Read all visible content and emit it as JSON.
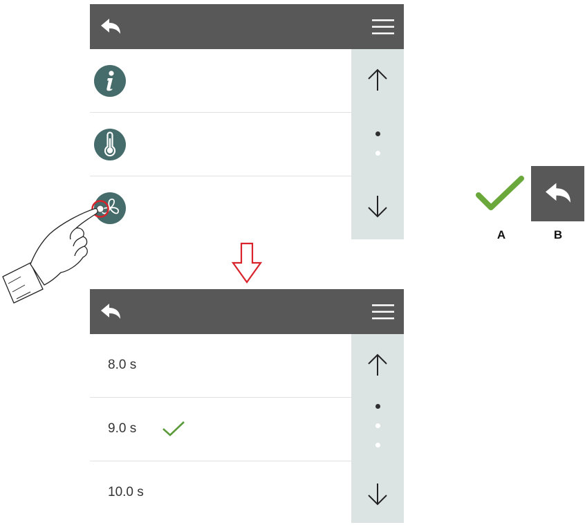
{
  "settings_list": {
    "items": [
      {
        "icon": "info-icon"
      },
      {
        "icon": "thermometer-icon"
      },
      {
        "icon": "fan-icon"
      }
    ],
    "scroll_dots": {
      "total": 2,
      "active": 1
    }
  },
  "value_list": {
    "items": [
      {
        "label": "8.0 s",
        "selected": false
      },
      {
        "label": "9.0 s",
        "selected": true
      },
      {
        "label": "10.0 s",
        "selected": false
      }
    ],
    "scroll_dots": {
      "total": 3,
      "active": 1
    }
  },
  "legend": {
    "a_label": "A",
    "b_label": "B"
  },
  "colors": {
    "toolbar": "#585858",
    "icon_circle": "#456b6a",
    "scrollbar": "#dbe4e2",
    "check": "#5a9a3a",
    "annotation_red": "#d9232a"
  }
}
